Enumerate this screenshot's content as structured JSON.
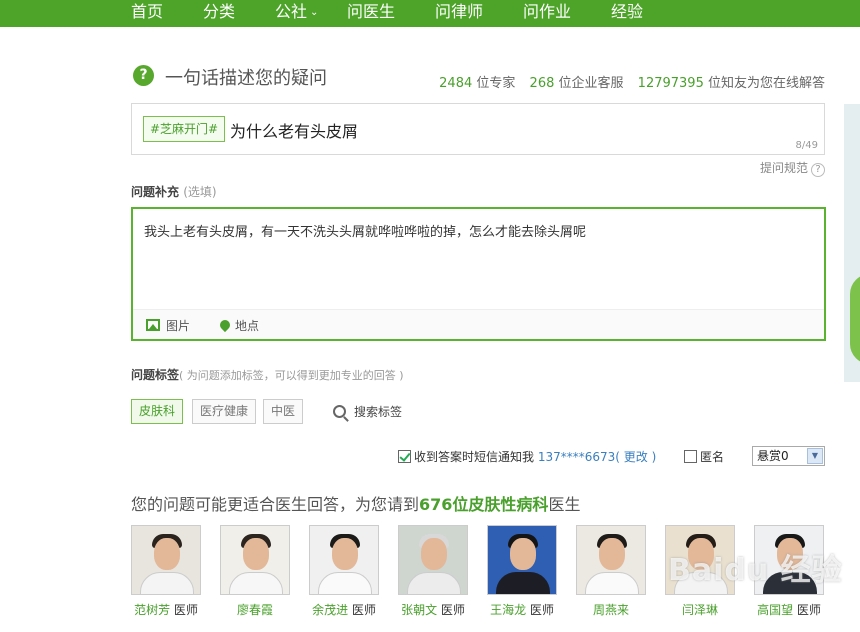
{
  "nav": {
    "items": [
      "首页",
      "分类",
      "公社",
      "问医生",
      "问律师",
      "问作业",
      "经验"
    ]
  },
  "ask": {
    "title": "一句话描述您的疑问",
    "stats": {
      "experts_num": "2484",
      "experts_label": "位专家",
      "service_num": "268",
      "service_label": "位企业客服",
      "users_num": "12797395",
      "users_label": "位知友为您在线解答"
    },
    "topic_tag": "#芝麻开门#",
    "question": "为什么老有头皮屑",
    "count": "8/49",
    "rule_link": "提问规范",
    "help_glyph": "?"
  },
  "supplement": {
    "label": "问题补充",
    "optional": "(选填)",
    "text": "我头上老有头皮屑，有一天不洗头头屑就哗啦哗啦的掉，怎么才能去除头屑呢",
    "image_btn": "图片",
    "location_btn": "地点"
  },
  "tags": {
    "label": "问题标签",
    "hint": "( 为问题添加标签，可以得到更加专业的回答 )",
    "items": [
      "皮肤科",
      "医疗健康",
      "中医"
    ],
    "search": "搜索标签"
  },
  "options": {
    "sms_text": "收到答案时短信通知我",
    "phone": "137****6673",
    "change": "( 更改 )",
    "anonymous": "匿名",
    "reward": "悬赏0"
  },
  "recommend": {
    "prefix": "您的问题可能更适合医生回答，为您请到",
    "count": "676位",
    "dept": "皮肤性病科",
    "suffix": "医生"
  },
  "doctors": [
    {
      "name": "范树芳",
      "title": "医师"
    },
    {
      "name": "廖春霞",
      "title": ""
    },
    {
      "name": "余茂进",
      "title": "医师"
    },
    {
      "name": "张朝文",
      "title": "医师"
    },
    {
      "name": "王海龙",
      "title": "医师"
    },
    {
      "name": "周燕来",
      "title": ""
    },
    {
      "name": "闫泽琳",
      "title": ""
    },
    {
      "name": "高国望",
      "title": "医师"
    }
  ],
  "watermark": "Baidu 经验",
  "colors": {
    "brand_green": "#4da429",
    "link_blue": "#3a7fbf"
  }
}
